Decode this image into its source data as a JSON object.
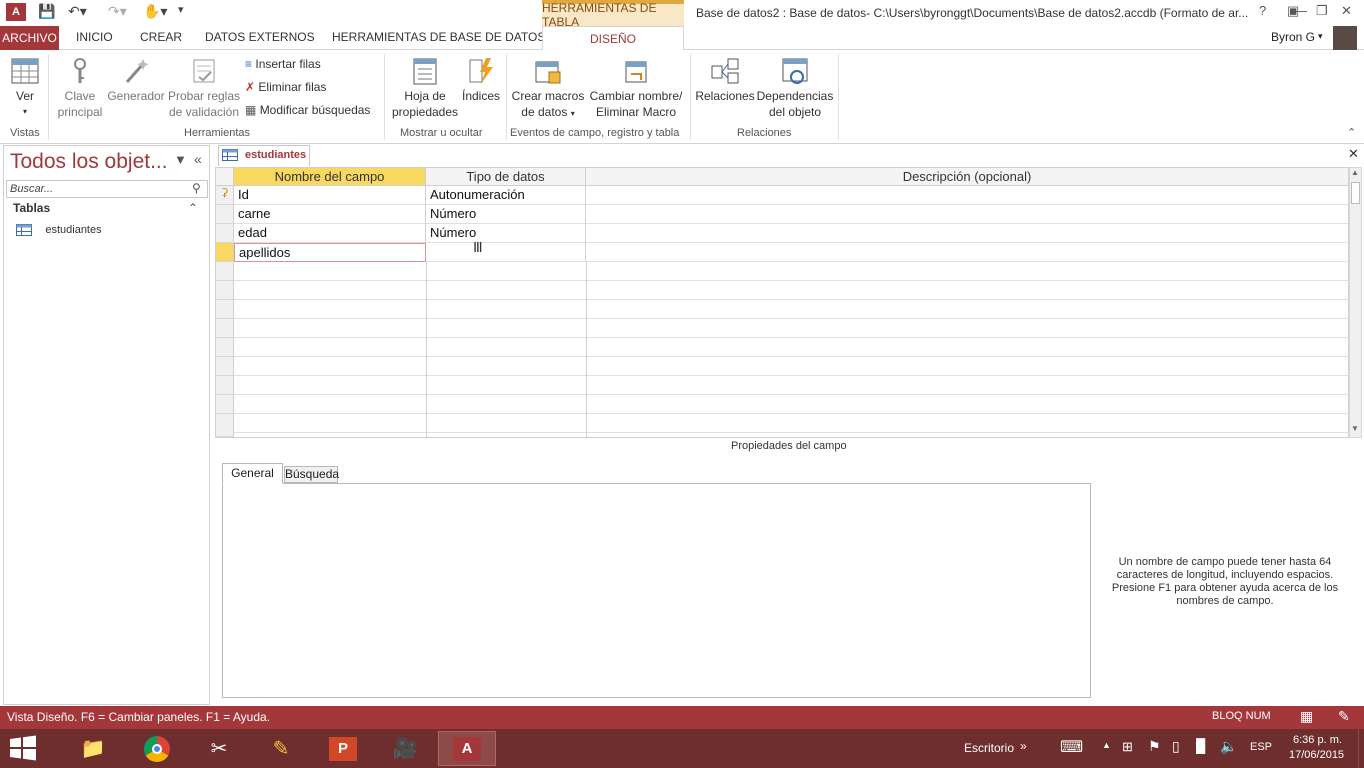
{
  "titlebar": {
    "context_tab": "HERRAMIENTAS DE TABLA",
    "window_title": "Base de datos2 : Base de datos- C:\\Users\\byronggt\\Documents\\Base de datos2.accdb (Formato de ar...",
    "help": "?",
    "user": "Byron G"
  },
  "tabs": {
    "archivo": "ARCHIVO",
    "inicio": "INICIO",
    "crear": "CREAR",
    "datos_externos": "DATOS EXTERNOS",
    "herramientas_bd": "HERRAMIENTAS DE BASE DE DATOS",
    "diseno": "DISEÑO"
  },
  "ribbon": {
    "ver": "Ver",
    "clave_1": "Clave",
    "clave_2": "principal",
    "generador": "Generador",
    "probar_1": "Probar reglas",
    "probar_2": "de validación",
    "insertar": "Insertar filas",
    "eliminar": "Eliminar filas",
    "modificar": "Modificar búsquedas",
    "hoja_1": "Hoja de",
    "hoja_2": "propiedades",
    "indices": "Índices",
    "crear_macros_1": "Crear macros",
    "crear_macros_2": "de datos",
    "cambiar_1": "Cambiar nombre/",
    "cambiar_2": "Eliminar Macro",
    "relaciones": "Relaciones",
    "dependencias_1": "Dependencias",
    "dependencias_2": "del objeto",
    "groups": {
      "vistas": "Vistas",
      "herramientas": "Herramientas",
      "mostrar": "Mostrar u ocultar",
      "eventos": "Eventos de campo, registro y tabla",
      "relaciones": "Relaciones"
    }
  },
  "nav": {
    "title": "Todos los objet...",
    "search_placeholder": "Buscar...",
    "section": "Tablas",
    "items": [
      "estudiantes"
    ]
  },
  "document": {
    "tab": "estudiantes",
    "columns": [
      "Nombre del campo",
      "Tipo de datos",
      "Descripción (opcional)"
    ],
    "rows": [
      {
        "name": "Id",
        "type": "Autonumeración",
        "desc": ""
      },
      {
        "name": "carne",
        "type": "Número",
        "desc": ""
      },
      {
        "name": "edad",
        "type": "Número",
        "desc": ""
      },
      {
        "name": "apellidos",
        "type": "",
        "desc": ""
      }
    ],
    "properties_label": "Propiedades del campo",
    "prop_tabs": [
      "General",
      "Búsqueda"
    ],
    "help_text": "Un nombre de campo puede tener hasta 64 caracteres de longitud, incluyendo espacios. Presione F1 para obtener ayuda acerca de los nombres de campo."
  },
  "status": {
    "left": "Vista Diseño.  F6 = Cambiar paneles.  F1 = Ayuda.",
    "numlock": "BLOQ NUM"
  },
  "taskbar": {
    "escritorio": "Escritorio",
    "lang": "ESP",
    "time": "6:36 p. m.",
    "date": "17/06/2015"
  }
}
